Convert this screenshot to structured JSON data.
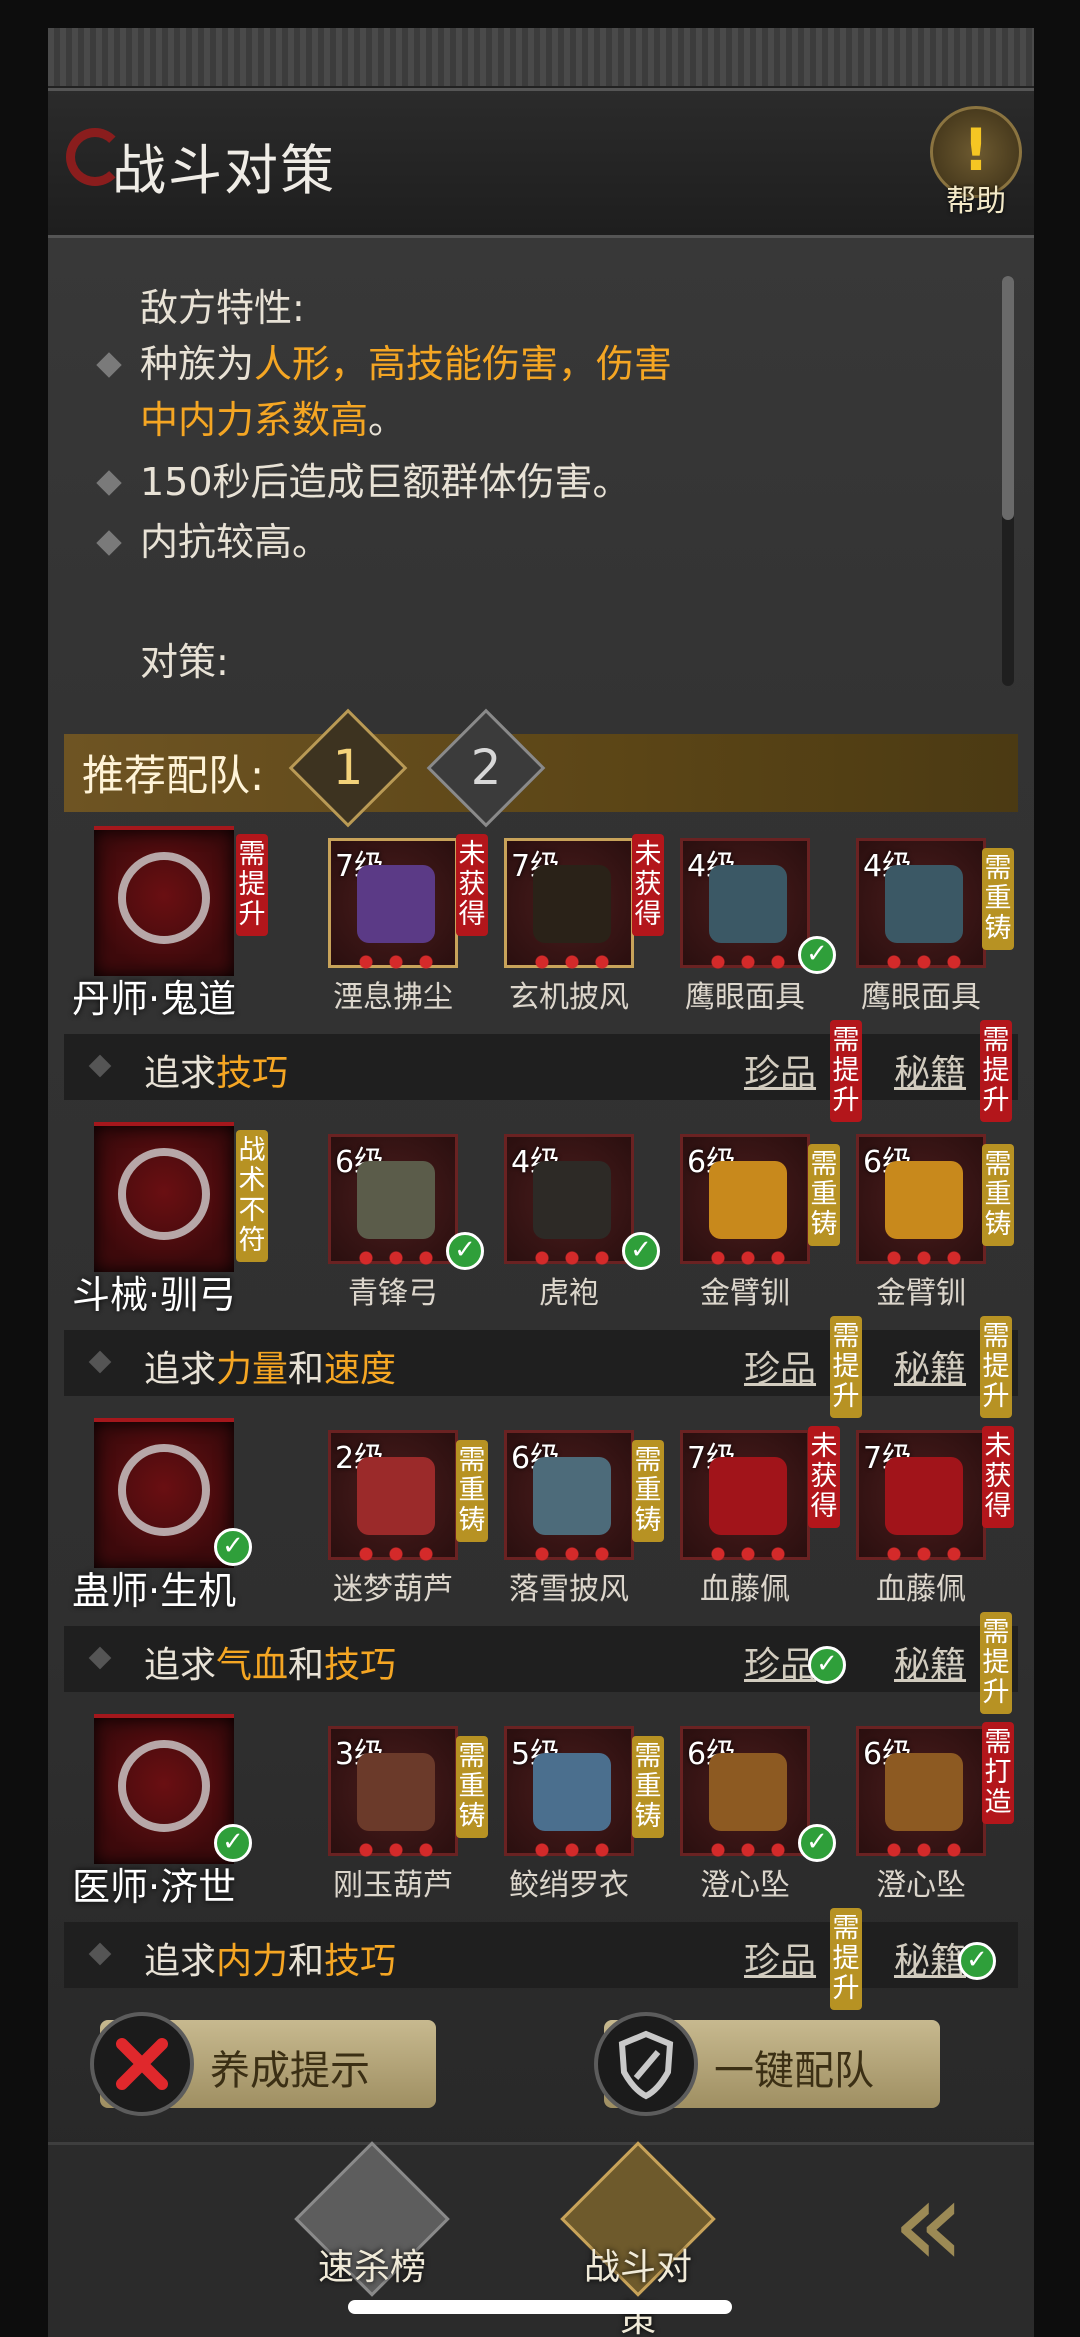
{
  "header": {
    "title": "战斗对策",
    "help_label": "帮助",
    "help_symbol": "!"
  },
  "enemy": {
    "heading": "敌方特性:",
    "line1_a": "种族为",
    "line1_b": "人形",
    "line1_c": "，",
    "line1_d": "高技能伤害，伤害中内力系",
    "line1_e": "数高",
    "line1_f": "。",
    "line2": "150秒后造成巨额群体伤害。",
    "line3": "内抗较高。",
    "strategy_heading": "对策:"
  },
  "recommend": {
    "title": "推荐配队:",
    "tab1": "1",
    "tab2": "2"
  },
  "rows": [
    {
      "hero": "丹师·鬼道",
      "hero_tag": "需提升",
      "items": [
        {
          "level": "7级",
          "name": "湮息拂尘",
          "tag": "未获得"
        },
        {
          "level": "7级",
          "name": "玄机披风",
          "tag": "未获得"
        },
        {
          "level": "4级",
          "name": "鹰眼面具",
          "tag": ""
        },
        {
          "level": "4级",
          "name": "鹰眼面具",
          "tag": "需重铸"
        }
      ],
      "pursuit_a": "追求",
      "pursuit_b": "技巧",
      "pursuit_c": "",
      "pursuit_d": "",
      "treasure": "珍品",
      "treasure_tag": "需提升",
      "manual": "秘籍",
      "manual_tag": "需提升"
    },
    {
      "hero": "斗械·驯弓",
      "hero_tag": "战术不符",
      "items": [
        {
          "level": "6级",
          "name": "青锋弓",
          "tag": ""
        },
        {
          "level": "4级",
          "name": "虎袍",
          "tag": ""
        },
        {
          "level": "6级",
          "name": "金臂钏",
          "tag": "需重铸"
        },
        {
          "level": "6级",
          "name": "金臂钏",
          "tag": "需重铸"
        }
      ],
      "pursuit_a": "追求",
      "pursuit_b": "力量",
      "pursuit_c": "和",
      "pursuit_d": "速度",
      "treasure": "珍品",
      "treasure_tag": "需提升",
      "manual": "秘籍",
      "manual_tag": "需提升"
    },
    {
      "hero": "蛊师·生机",
      "hero_tag": "",
      "items": [
        {
          "level": "2级",
          "name": "迷梦葫芦",
          "tag": "需重铸"
        },
        {
          "level": "6级",
          "name": "落雪披风",
          "tag": "需重铸"
        },
        {
          "level": "7级",
          "name": "血藤佩",
          "tag": "未获得"
        },
        {
          "level": "7级",
          "name": "血藤佩",
          "tag": "未获得"
        }
      ],
      "pursuit_a": "追求",
      "pursuit_b": "气血",
      "pursuit_c": "和",
      "pursuit_d": "技巧",
      "treasure": "珍品",
      "treasure_tag": "",
      "manual": "秘籍",
      "manual_tag": "需提升"
    },
    {
      "hero": "医师·济世",
      "hero_tag": "",
      "items": [
        {
          "level": "3级",
          "name": "刚玉葫芦",
          "tag": "需重铸"
        },
        {
          "level": "5级",
          "name": "鲛绡罗衣",
          "tag": "需重铸"
        },
        {
          "level": "6级",
          "name": "澄心坠",
          "tag": ""
        },
        {
          "level": "6级",
          "name": "澄心坠",
          "tag": "需打造"
        }
      ],
      "pursuit_a": "追求",
      "pursuit_b": "内力",
      "pursuit_c": "和",
      "pursuit_d": "技巧",
      "treasure": "珍品",
      "treasure_tag": "需提升",
      "manual": "秘籍",
      "manual_tag": ""
    }
  ],
  "buttons": {
    "hint": "养成提示",
    "auto": "一键配队"
  },
  "bottom_nav": {
    "tab1": "速杀榜",
    "tab2": "战斗对策"
  },
  "colors": {
    "accent_orange": "#f5a623",
    "tag_red": "#b3161b",
    "tag_gold": "#b79223",
    "check_green": "#2f9f3a"
  }
}
